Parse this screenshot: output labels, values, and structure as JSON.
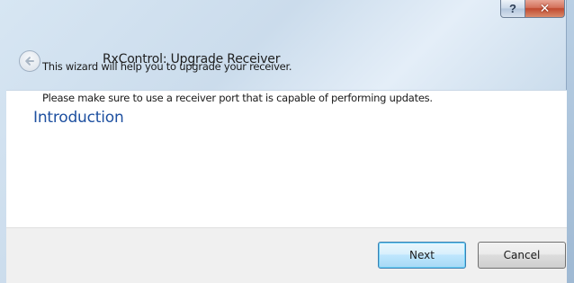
{
  "window": {
    "title": "RxControl: Upgrade Receiver",
    "help_glyph": "?",
    "close_glyph": "✕"
  },
  "page": {
    "heading": "Introduction",
    "lines": [
      "This wizard will help you to upgrade your receiver.",
      "Please make sure to use a receiver port that is capable of performing updates."
    ]
  },
  "footer": {
    "next_label": "Next",
    "cancel_label": "Cancel"
  },
  "icons": {
    "back": "back-arrow-icon",
    "help": "help-icon",
    "close": "close-icon"
  },
  "colors": {
    "heading": "#1e50a0",
    "close_button": "#c04a30",
    "default_button_border": "#3c7fb1"
  }
}
